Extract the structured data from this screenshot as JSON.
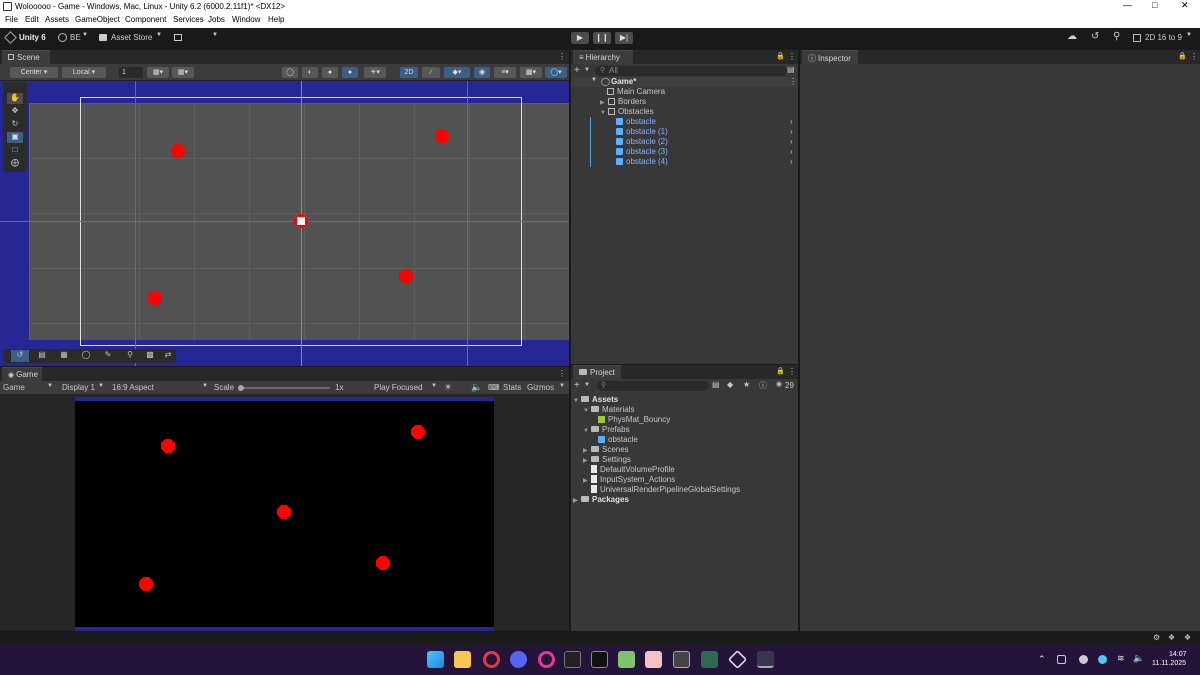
{
  "window": {
    "title": "Wolooooo - Game - Windows, Mac, Linux - Unity 6.2 (6000.2.11f1)* <DX12>"
  },
  "menu": [
    "File",
    "Edit",
    "Assets",
    "GameObject",
    "Component",
    "Services",
    "Jobs",
    "Window",
    "Help"
  ],
  "toolbar": {
    "unity": "Unity 6",
    "account": "BE",
    "asset_store": "Asset Store",
    "layout": "2D 16 to 9"
  },
  "scene": {
    "tab": "Scene",
    "pivot": "Center",
    "space": "Local",
    "grid_value": "1",
    "mode_2d": "2D"
  },
  "game": {
    "tab": "Game",
    "view": "Game",
    "display": "Display 1",
    "aspect": "16:9 Aspect",
    "scale_label": "Scale",
    "scale_value": "1x",
    "play_mode": "Play Focused",
    "stats": "Stats",
    "gizmos": "Gizmos"
  },
  "hierarchy": {
    "tab": "Hierarchy",
    "search_placeholder": "All",
    "scene_name": "Game*",
    "items": [
      "Main Camera",
      "Borders",
      "Obstacles"
    ],
    "obstacles": [
      "obstacle",
      "obstacle (1)",
      "obstacle (2)",
      "obstacle (3)",
      "obstacle (4)"
    ]
  },
  "inspector": {
    "tab": "Inspector"
  },
  "project": {
    "tab": "Project",
    "count": "29",
    "assets_root": "Assets",
    "materials": "Materials",
    "physmat": "PhysMat_Bouncy",
    "prefabs": "Prefabs",
    "prefab_obstacle": "obstacle",
    "scenes": "Scenes",
    "settings": "Settings",
    "volume": "DefaultVolumeProfile",
    "input": "InputSystem_Actions",
    "urp": "UniversalRenderPipelineGlobalSettings",
    "packages": "Packages"
  },
  "clock": {
    "time": "14:07",
    "date": "11.11.2025"
  },
  "colors": {
    "obstacle": "#ff0000",
    "scene_border": "#262694",
    "taskbar": "#24143a"
  }
}
